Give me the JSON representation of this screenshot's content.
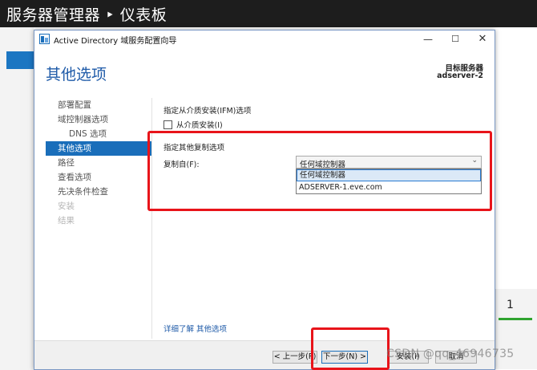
{
  "background": {
    "app_title": "服务器管理器 ‣ 仪表板",
    "tile_count": "1"
  },
  "window": {
    "title": "Active Directory 域服务配置向导",
    "minimize": "—",
    "maximize": "☐",
    "close": "✕"
  },
  "header": {
    "page_title": "其他选项",
    "target_label": "目标服务器",
    "target_server": "adserver-2"
  },
  "nav": {
    "items": [
      {
        "label": "部署配置",
        "state": "normal",
        "sub": false
      },
      {
        "label": "域控制器选项",
        "state": "normal",
        "sub": false
      },
      {
        "label": "DNS 选项",
        "state": "normal",
        "sub": true
      },
      {
        "label": "其他选项",
        "state": "active",
        "sub": false
      },
      {
        "label": "路径",
        "state": "normal",
        "sub": false
      },
      {
        "label": "查看选项",
        "state": "normal",
        "sub": false
      },
      {
        "label": "先决条件检查",
        "state": "normal",
        "sub": false
      },
      {
        "label": "安装",
        "state": "disabled",
        "sub": false
      },
      {
        "label": "结果",
        "state": "disabled",
        "sub": false
      }
    ]
  },
  "content": {
    "ifm_title": "指定从介质安装(IFM)选项",
    "ifm_checkbox_label": "从介质安装(I)",
    "replication_title": "指定其他复制选项",
    "replicate_from_label": "复制自(F):",
    "replicate_from_value": "任何域控制器",
    "chevron": "⌄",
    "options": [
      "任何域控制器",
      "ADSERVER-1.eve.com"
    ],
    "learn_more": "详细了解 其他选项"
  },
  "buttons": {
    "prev": "< 上一步(P)",
    "next": "下一步(N) >",
    "install": "安装(I)",
    "cancel": "取消"
  },
  "watermark": "CSDN @qq_46946735",
  "colors": {
    "accent": "#1a6eba",
    "title_blue": "#1e5aa8",
    "annotation_red": "#e8141a"
  }
}
